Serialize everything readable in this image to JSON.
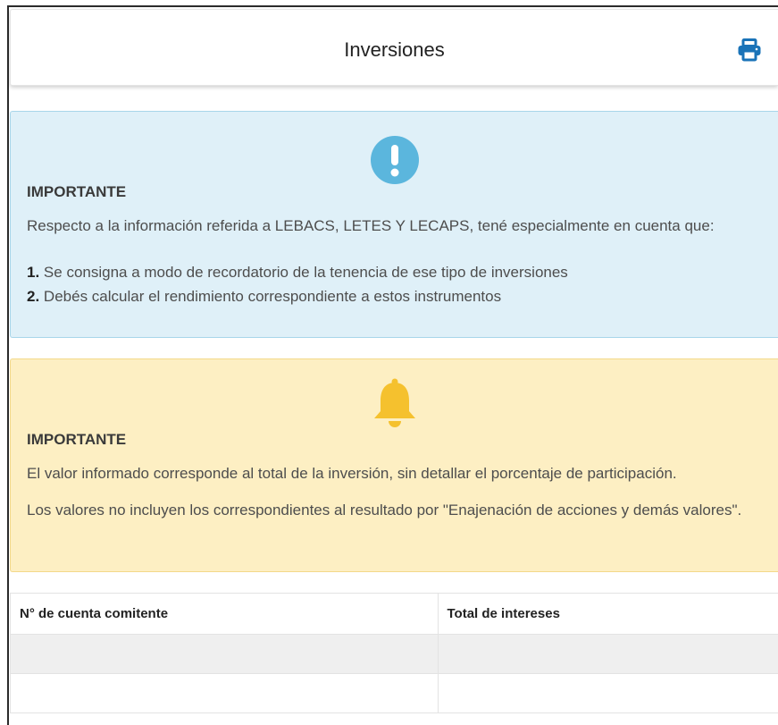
{
  "header": {
    "title": "Inversiones",
    "print_icon": "print-icon",
    "accent_color": "#1a73b8"
  },
  "alert_info": {
    "icon": "exclamation-circle-icon",
    "icon_color": "#5bb6dd",
    "heading": "IMPORTANTE",
    "intro": "Respecto a la información referida a LEBACS, LETES Y LECAPS, tené especialmente en cuenta que:",
    "items": [
      {
        "number": "1.",
        "text": "Se consigna a modo de recordatorio de la tenencia de ese tipo de inversiones"
      },
      {
        "number": "2.",
        "text": "Debés calcular el rendimiento correspondiente a estos instrumentos"
      }
    ]
  },
  "alert_warning": {
    "icon": "bell-icon",
    "icon_color": "#f5c12e",
    "heading": "IMPORTANTE",
    "paragraph_1": "El valor informado corresponde al total de la inversión, sin detallar el porcentaje de participación.",
    "paragraph_2": "Los valores no incluyen los correspondientes al resultado por \"Enajenación de acciones y demás valores\"."
  },
  "table": {
    "columns": [
      "N° de cuenta comitente",
      "Total de intereses"
    ],
    "rows": [
      [
        "",
        ""
      ],
      [
        "",
        ""
      ]
    ]
  }
}
